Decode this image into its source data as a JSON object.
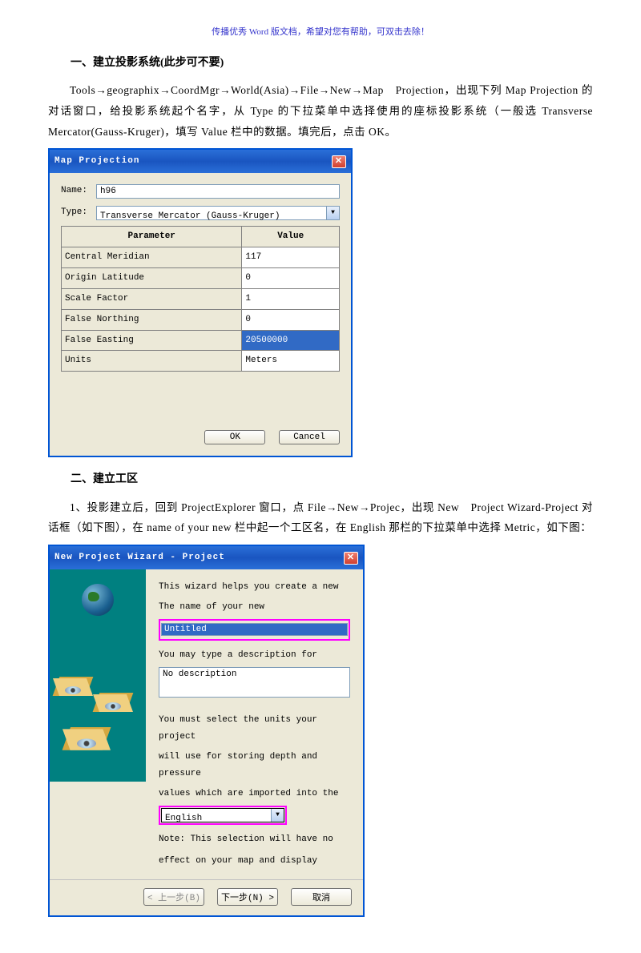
{
  "header_note": "传播优秀 Word 版文档，希望对您有帮助，可双击去除！",
  "section1": {
    "heading": "一、建立投影系统(此步可不要)",
    "para": "Tools→geographix→CoordMgr→World(Asia)→File→New→Map　Projection，出现下列 Map Projection 的对话窗口，给投影系统起个名字，从 Type 的下拉菜单中选择使用的座标投影系统（一般选 Transverse Mercator(Gauss-Kruger)，填写 Value 栏中的数据。填完后，点击 OK。"
  },
  "dialog1": {
    "title": "Map Projection",
    "name_label": "Name:",
    "name_value": "h96",
    "type_label": "Type:",
    "type_value": "Transverse Mercator (Gauss-Kruger)",
    "col_param": "Parameter",
    "col_value": "Value",
    "rows": [
      {
        "p": "Central Meridian",
        "v": "117"
      },
      {
        "p": "Origin Latitude",
        "v": "0"
      },
      {
        "p": "Scale Factor",
        "v": "1"
      },
      {
        "p": "False Northing",
        "v": "0"
      },
      {
        "p": "False Easting",
        "v": "20500000"
      },
      {
        "p": "Units",
        "v": "Meters"
      }
    ],
    "ok": "OK",
    "cancel": "Cancel"
  },
  "section2": {
    "heading": "二、建立工区",
    "para": "1、投影建立后，回到 ProjectExplorer 窗口，点 File→New→Projec，出现 New　Project Wizard-Project 对话框（如下图），在 name of your new 栏中起一个工区名，在 English 那栏的下拉菜单中选择 Metric，如下图："
  },
  "dialog2": {
    "title": "New Project Wizard - Project",
    "line1": "This wizard helps you create a new",
    "line2": "The name of your new",
    "name_value": "Untitled",
    "line3": "You may type a description for",
    "desc_value": "No description",
    "line4a": "You must select the units your project",
    "line4b": "will use for storing depth and pressure",
    "line4c": "values which are imported into the",
    "unit_value": "English",
    "note1": "Note:  This selection will have no",
    "note2": "effect on your map and display",
    "back": "< 上一步(B)",
    "next": "下一步(N) >",
    "cancel": "取消"
  }
}
